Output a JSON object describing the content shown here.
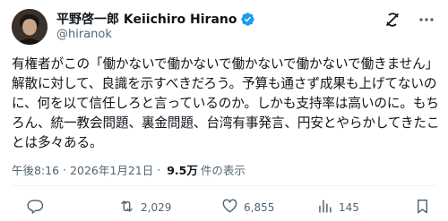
{
  "author": {
    "display_name": "平野啓一郎 Keiichiro Hirano",
    "handle": "@hiranok",
    "verified": true
  },
  "tweet": {
    "lines": [
      "有権者がこの「働かないで働かないで働かないで働かないで働きません」",
      "解散に対して、良識を示すべきだろう。予算も通さず成果も上げてないの",
      "に、何を以て信任しろと言っているのか。しかも支持率は高いのに。もち",
      "ろん、統一教会問題、裏金問題、台湾有事発言、円安とやらかしてきたこ",
      "とは多々ある。"
    ]
  },
  "meta": {
    "time": "午後8:16",
    "separator": "·",
    "date": "2026年1月21日",
    "views_count": "9.5万",
    "views_label": "件の表示"
  },
  "actions": {
    "reply_count": "",
    "retweet_count": "2,029",
    "like_count": "6,855",
    "views_count": "145",
    "bookmark_count": ""
  },
  "icons": {
    "verified": "verified-badge-icon",
    "grok": "grok-icon",
    "more": "more-icon",
    "reply": "reply-icon",
    "retweet": "retweet-icon",
    "like": "heart-icon",
    "views": "bar-chart-icon",
    "bookmark": "bookmark-icon"
  },
  "colors": {
    "text": "#0f1419",
    "secondary": "#536471",
    "verified": "#1d9bf0",
    "divider": "#eff3f4"
  }
}
